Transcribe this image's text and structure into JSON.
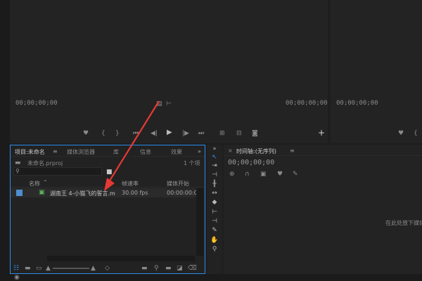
{
  "source_monitor": {
    "timecode_left": "00;00;00;00",
    "timecode_right": "00;00;00;00",
    "icons": [
      "marker-icon",
      "in-point-icon",
      "out-point-icon",
      "go-to-in-icon",
      "step-back-icon",
      "play-icon",
      "step-forward-icon",
      "go-to-out-icon",
      "insert-icon",
      "overwrite-icon",
      "export-frame-icon",
      "add-button-icon"
    ]
  },
  "program_monitor": {
    "timecode": "00;00;00;00"
  },
  "project_panel": {
    "tabs": [
      "项目:未命名",
      "媒体浏览器",
      "库",
      "信息",
      "效果"
    ],
    "overflow": "»",
    "project_file": "未命名.prproj",
    "item_count": "1 个项",
    "columns": {
      "name": "名称",
      "frame_rate": "帧速率",
      "media_start": "媒体开始"
    },
    "rows": [
      {
        "name": "湖南王 4-小猫飞的誓言.m",
        "frame_rate": "30.00 fps",
        "media_start": "00:00:00:0"
      }
    ]
  },
  "timeline_panel": {
    "tab": "时间轴:(无序列)",
    "timecode": "00;00;00;00",
    "drop_hint": "在此处放下媒体"
  },
  "colors": {
    "accent": "#2d8ceb",
    "arrow": "#e53935",
    "panel_bg": "#232323"
  }
}
